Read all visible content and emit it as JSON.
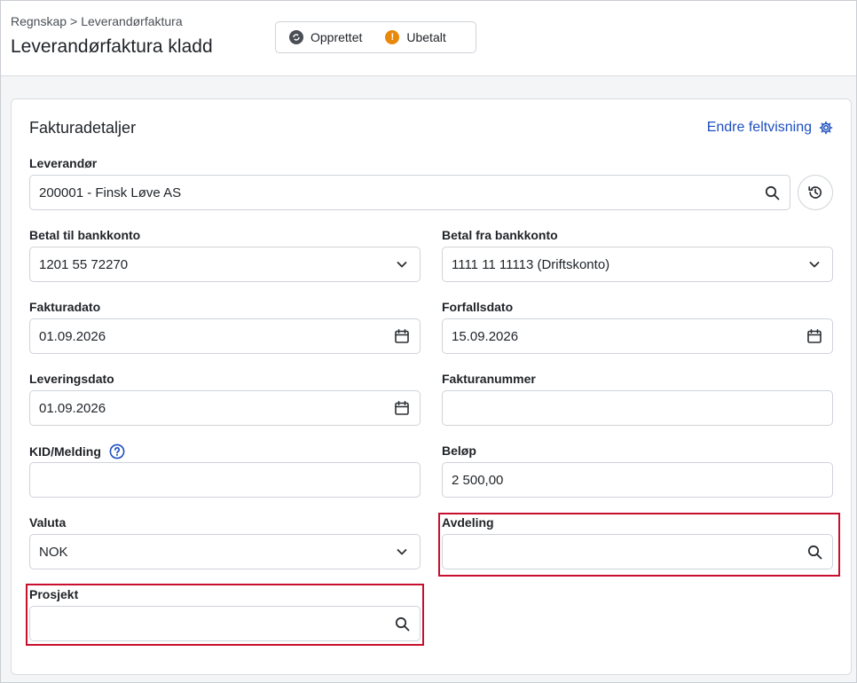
{
  "breadcrumb": {
    "parent": "Regnskap",
    "separator": ">",
    "current": "Leverandørfaktura"
  },
  "page_title": "Leverandørfaktura kladd",
  "status": {
    "created_label": "Opprettet",
    "unpaid_label": "Ubetalt",
    "unpaid_icon_glyph": "!"
  },
  "card": {
    "title": "Fakturadetaljer",
    "edit_link": "Endre feltvisning"
  },
  "fields": {
    "supplier": {
      "label": "Leverandør",
      "value": "200001 - Finsk Løve AS"
    },
    "pay_to_account": {
      "label": "Betal til bankkonto",
      "value": "1201 55 72270"
    },
    "pay_from_account": {
      "label": "Betal fra bankkonto",
      "value": "1111 11 11113 (Driftskonto)"
    },
    "invoice_date": {
      "label": "Fakturadato",
      "value": "01.09.2026"
    },
    "due_date": {
      "label": "Forfallsdato",
      "value": "15.09.2026"
    },
    "delivery_date": {
      "label": "Leveringsdato",
      "value": "01.09.2026"
    },
    "invoice_number": {
      "label": "Fakturanummer",
      "value": ""
    },
    "kid": {
      "label": "KID/Melding",
      "value": ""
    },
    "amount": {
      "label": "Beløp",
      "value": "2 500,00"
    },
    "currency": {
      "label": "Valuta",
      "value": "NOK"
    },
    "department": {
      "label": "Avdeling",
      "value": ""
    },
    "project": {
      "label": "Prosjekt",
      "value": ""
    }
  },
  "icons": {
    "search": "search-icon",
    "history": "history-icon",
    "chevron": "chevron-down-icon",
    "calendar": "calendar-icon",
    "gear": "gear-icon",
    "help": "help-icon"
  },
  "colors": {
    "accent": "#1d4fbf",
    "highlight": "#c8102e",
    "unpaid": "#e8890c",
    "created": "#4a4f55"
  }
}
